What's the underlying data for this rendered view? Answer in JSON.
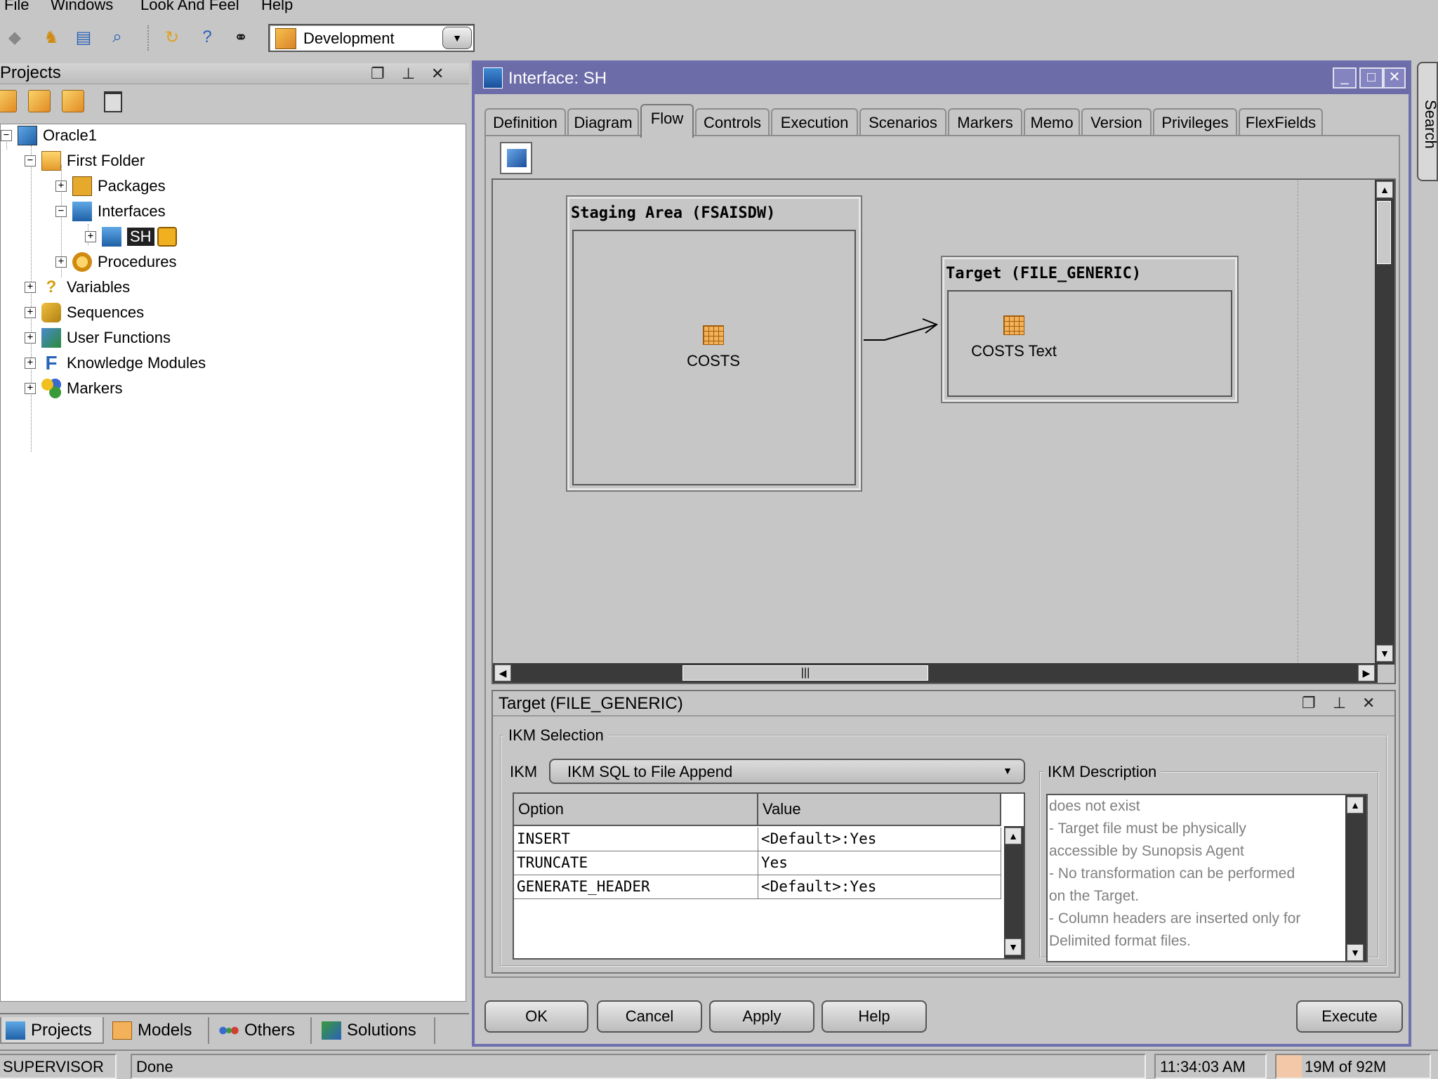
{
  "menu": [
    "File",
    "Windows",
    "Look And Feel",
    "Help"
  ],
  "toolbar": {
    "context": "Development"
  },
  "projects": {
    "title": "Projects",
    "tree": [
      {
        "label": "Oracle1"
      },
      {
        "label": "First Folder"
      },
      {
        "label": "Packages"
      },
      {
        "label": "Interfaces"
      },
      {
        "label": "SH"
      },
      {
        "label": "Procedures"
      },
      {
        "label": "Variables"
      },
      {
        "label": "Sequences"
      },
      {
        "label": "User Functions"
      },
      {
        "label": "Knowledge Modules"
      },
      {
        "label": "Markers"
      }
    ],
    "bottom_tabs": [
      "Projects",
      "Models",
      "Others",
      "Solutions"
    ]
  },
  "interface": {
    "title": "Interface: SH",
    "tabs": [
      "Definition",
      "Diagram",
      "Flow",
      "Controls",
      "Execution",
      "Scenarios",
      "Markers",
      "Memo",
      "Version",
      "Privileges",
      "FlexFields"
    ],
    "active_tab": "Flow",
    "staging": {
      "title": "Staging Area (FSAISDW)",
      "datastore": "COSTS"
    },
    "target": {
      "title": "Target (FILE_GENERIC)",
      "datastore": "COSTS Text"
    },
    "scroll_grip": "|||",
    "props": {
      "title": "Target (FILE_GENERIC)",
      "group_label": "IKM Selection",
      "ikm_label": "IKM",
      "ikm_value": "IKM SQL to File Append",
      "columns": [
        "Option",
        "Value"
      ],
      "rows": [
        [
          "INSERT",
          "<Default>:Yes"
        ],
        [
          "TRUNCATE",
          "Yes"
        ],
        [
          "GENERATE_HEADER",
          "<Default>:Yes"
        ]
      ],
      "desc_label": "IKM Description",
      "desc_lines": [
        "does not exist",
        "- Target file must be physically",
        "accessible by Sunopsis Agent",
        "- No transformation can be performed",
        "on the Target.",
        "- Column headers are inserted only for",
        "Delimited format files."
      ]
    },
    "buttons": {
      "ok": "OK",
      "cancel": "Cancel",
      "apply": "Apply",
      "help": "Help",
      "execute": "Execute"
    }
  },
  "search_strip": "Search",
  "status": {
    "user": "SUPERVISOR",
    "message": "Done",
    "time": "11:34:03 AM",
    "memory": "19M of 92M"
  },
  "colors": {
    "title_bar": "#6b6ca8",
    "panel": "#c6c6c6"
  }
}
